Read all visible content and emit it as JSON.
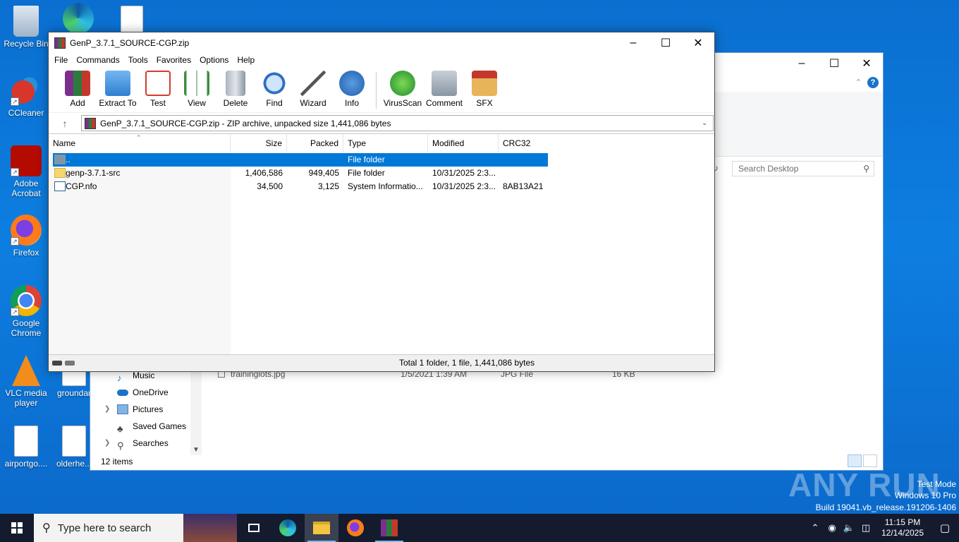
{
  "desktop": {
    "icons": [
      {
        "label": "Recycle Bin",
        "icon": "recycle-bin-icon"
      },
      {
        "label": "CCleaner",
        "icon": "ccleaner-icon"
      },
      {
        "label": "Adobe Acrobat",
        "icon": "acrobat-icon"
      },
      {
        "label": "Firefox",
        "icon": "firefox-icon"
      },
      {
        "label": "Google Chrome",
        "icon": "chrome-icon"
      },
      {
        "label": "VLC media player",
        "icon": "vlc-icon"
      },
      {
        "label": "airportgo....",
        "icon": "image-file-icon"
      },
      {
        "label": "groundar",
        "icon": "word-doc-icon"
      },
      {
        "label": "olderhe...",
        "icon": "word-doc-icon"
      }
    ]
  },
  "explorer": {
    "search_placeholder": "Search Desktop",
    "nav_items": [
      {
        "label": "Music",
        "icon": "music-icon",
        "expandable": false
      },
      {
        "label": "OneDrive",
        "icon": "onedrive-icon",
        "expandable": false
      },
      {
        "label": "Pictures",
        "icon": "pictures-icon",
        "expandable": true
      },
      {
        "label": "Saved Games",
        "icon": "saved-games-icon",
        "expandable": false
      },
      {
        "label": "Searches",
        "icon": "searches-icon",
        "expandable": true
      }
    ],
    "status": "12 items",
    "file_row": {
      "name": "traininglots.jpg",
      "date": "1/5/2021 1:39 AM",
      "type": "JPG File",
      "size": "16 KB"
    }
  },
  "winrar": {
    "title": "GenP_3.7.1_SOURCE-CGP.zip",
    "menu": [
      "File",
      "Commands",
      "Tools",
      "Favorites",
      "Options",
      "Help"
    ],
    "toolbar": [
      {
        "label": "Add",
        "icon": "add-archive-icon",
        "color": "#c0392b"
      },
      {
        "label": "Extract To",
        "icon": "extract-folder-icon",
        "color": "#3a8ee6"
      },
      {
        "label": "Test",
        "icon": "test-checklist-icon",
        "color": "#d33c2f"
      },
      {
        "label": "View",
        "icon": "view-book-icon",
        "color": "#3c8d3f"
      },
      {
        "label": "Delete",
        "icon": "delete-trash-icon",
        "color": "#8a96a3"
      },
      {
        "label": "Find",
        "icon": "find-magnifier-icon",
        "color": "#2f6fc4"
      },
      {
        "label": "Wizard",
        "icon": "wizard-wand-icon",
        "color": "#6a5acd"
      },
      {
        "label": "Info",
        "icon": "info-icon",
        "color": "#2f6fc4"
      },
      {
        "label": "VirusScan",
        "icon": "virusscan-icon",
        "color": "#2e9e3a"
      },
      {
        "label": "Comment",
        "icon": "comment-icon",
        "color": "#7d8b99"
      },
      {
        "label": "SFX",
        "icon": "sfx-box-icon",
        "color": "#d98c2b"
      }
    ],
    "address": "GenP_3.7.1_SOURCE-CGP.zip - ZIP archive, unpacked size 1,441,086 bytes",
    "columns": [
      "Name",
      "Size",
      "Packed",
      "Type",
      "Modified",
      "CRC32"
    ],
    "rows": [
      {
        "name": "..",
        "size": "",
        "packed": "",
        "type": "File folder",
        "modified": "",
        "crc": "",
        "icon": "parent-folder-icon"
      },
      {
        "name": "genp-3.7.1-src",
        "size": "1,406,586",
        "packed": "949,405",
        "type": "File folder",
        "modified": "10/31/2025 2:3...",
        "crc": "",
        "icon": "folder-icon"
      },
      {
        "name": "CGP.nfo",
        "size": "34,500",
        "packed": "3,125",
        "type": "System Informatio...",
        "modified": "10/31/2025 2:3...",
        "crc": "8AB13A21",
        "icon": "nfo-file-icon"
      }
    ],
    "status": "Total 1 folder, 1 file, 1,441,086 bytes"
  },
  "watermark": {
    "brand": "ANY RUN",
    "lines": [
      "Test Mode",
      "Windows 10 Pro",
      "Build 19041.vb_release.191206-1406"
    ]
  },
  "taskbar": {
    "search_placeholder": "Type here to search",
    "time": "11:15 PM",
    "date": "12/14/2025"
  }
}
